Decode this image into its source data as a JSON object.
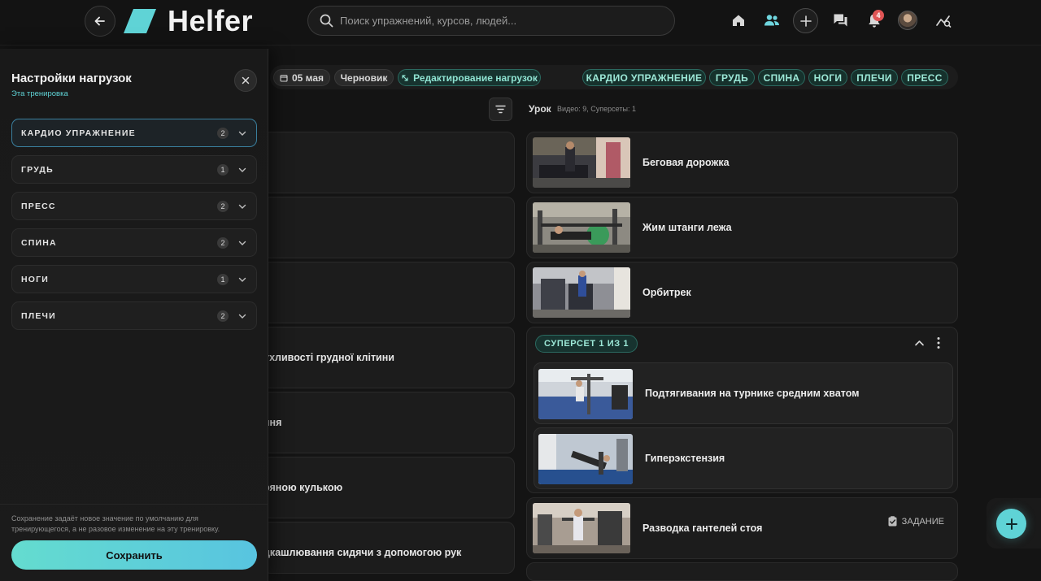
{
  "header": {
    "logo_text": "Helfer",
    "search_placeholder": "Поиск упражнений, курсов, людей...",
    "notifications_count": "4"
  },
  "filters": {
    "date": "05 мая",
    "status": "Черновик",
    "edit_loads": "Редактирование нагрузок",
    "categories": [
      "КАРДИО УПРАЖНЕНИЕ",
      "ГРУДЬ",
      "СПИНА",
      "НОГИ",
      "ПЛЕЧИ",
      "ПРЕСС"
    ]
  },
  "lesson": {
    "title": "Урок",
    "meta": "Видео: 9, Суперсеты: 1"
  },
  "left_list": [
    "",
    "",
    "",
    "ухливості грудної клітини",
    "ння",
    "ряною кулькою",
    "дкашлювання сидячи з допомогою рук"
  ],
  "exercises": [
    {
      "title": "Беговая дорожка"
    },
    {
      "title": "Жим штанги лежа"
    },
    {
      "title": "Орбитрек"
    }
  ],
  "superset": {
    "label": "СУПЕРСЕТ 1 ИЗ 1",
    "items": [
      {
        "title": "Подтягивания на турнике средним хватом"
      },
      {
        "title": "Гиперэкстензия"
      }
    ]
  },
  "after_superset": {
    "title": "Разводка гантелей стоя",
    "task_label": "ЗАДАНИЕ"
  },
  "panel": {
    "title": "Настройки нагрузок",
    "subtitle": "Эта тренировка",
    "categories": [
      {
        "label": "КАРДИО УПРАЖНЕНИЕ",
        "count": "2"
      },
      {
        "label": "ГРУДЬ",
        "count": "1"
      },
      {
        "label": "ПРЕСС",
        "count": "2"
      },
      {
        "label": "СПИНА",
        "count": "2"
      },
      {
        "label": "НОГИ",
        "count": "1"
      },
      {
        "label": "ПЛЕЧИ",
        "count": "2"
      }
    ],
    "note": "Сохранение задаёт новое значение по умолчанию для тренирующегося, а не разовое изменение на эту тренировку.",
    "save_label": "Сохранить"
  },
  "colors": {
    "accent": "#5fd3d6",
    "teal_pill_text": "#9ce8d7",
    "badge": "#e05555"
  }
}
